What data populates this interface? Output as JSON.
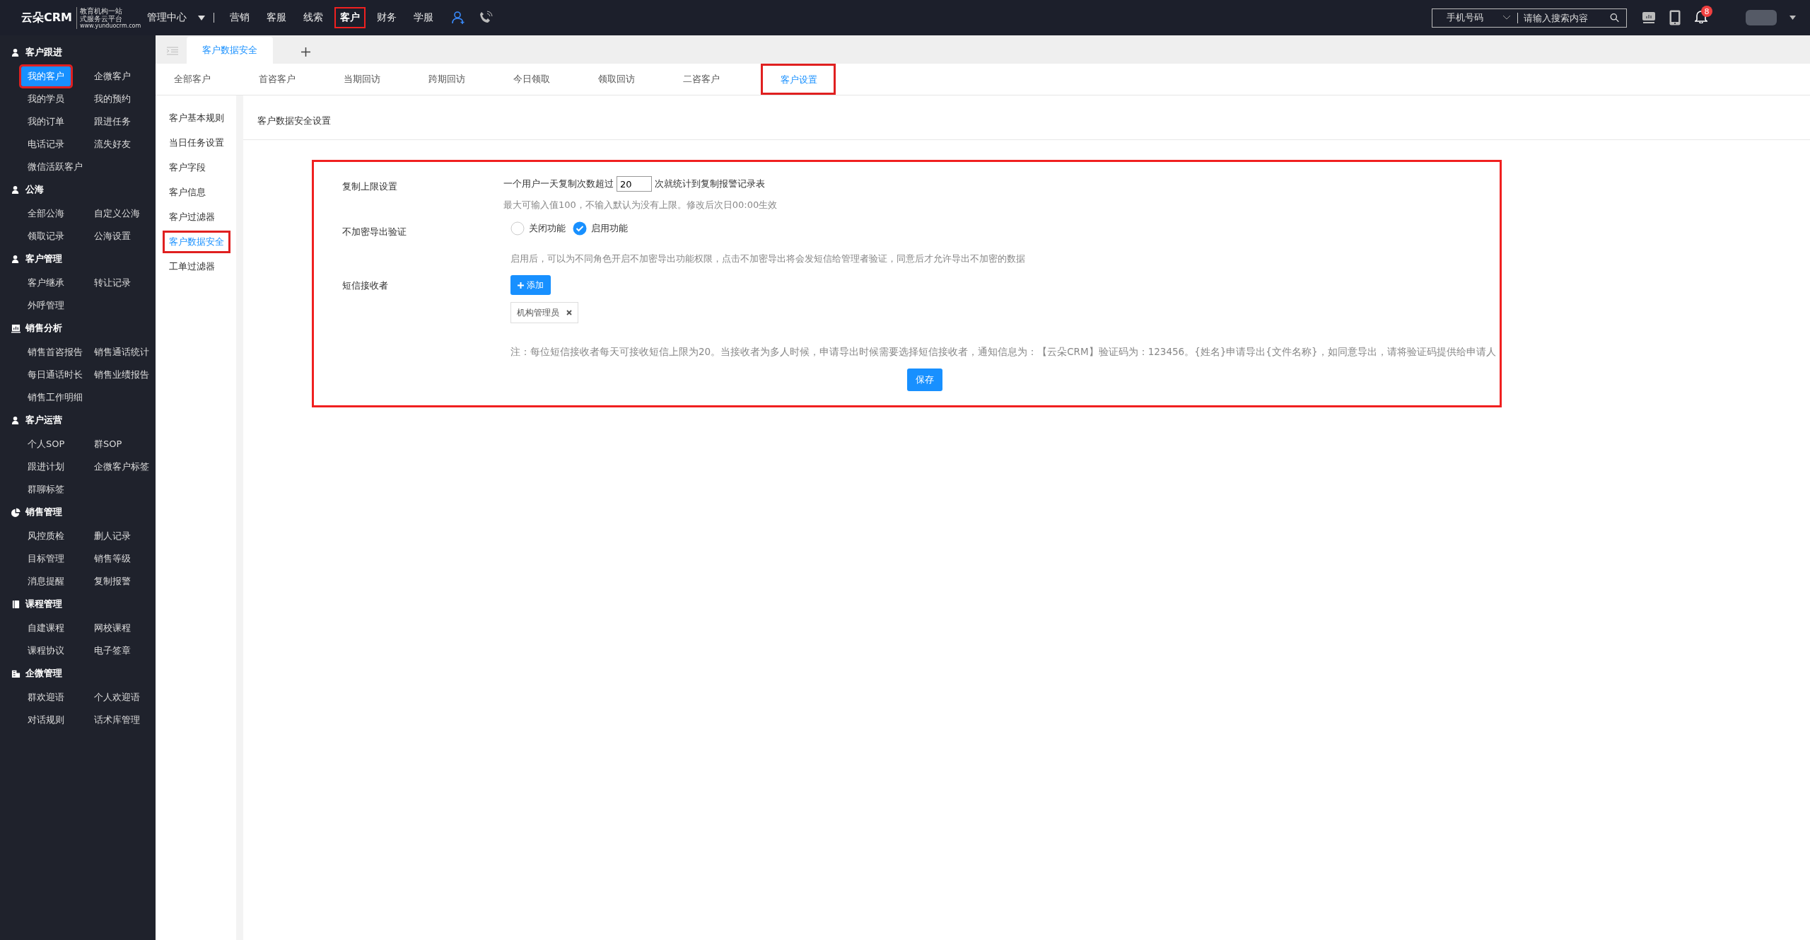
{
  "header": {
    "logo": {
      "name": "云朵CRM",
      "tagline_1": "教育机构一站",
      "tagline_2": "式服务云平台",
      "url": "www.yunduocrm.com"
    },
    "menu_dropdown": "管理中心",
    "nav": [
      {
        "label": "营销",
        "selected": false
      },
      {
        "label": "客服",
        "selected": false
      },
      {
        "label": "线索",
        "selected": false
      },
      {
        "label": "客户",
        "selected": true
      },
      {
        "label": "财务",
        "selected": false
      },
      {
        "label": "学服",
        "selected": false
      }
    ],
    "search": {
      "type": "手机号码",
      "placeholder": "请输入搜索内容"
    },
    "notification_count": "8"
  },
  "sidebar": [
    {
      "title": "客户跟进",
      "kind": "person",
      "items": [
        {
          "label": "我的客户",
          "selected": true
        },
        {
          "label": "企微客户",
          "selected": false
        },
        {
          "label": "我的学员",
          "selected": false
        },
        {
          "label": "我的预约",
          "selected": false
        },
        {
          "label": "我的订单",
          "selected": false
        },
        {
          "label": "跟进任务",
          "selected": false
        },
        {
          "label": "电话记录",
          "selected": false
        },
        {
          "label": "流失好友",
          "selected": false
        },
        {
          "label": "微信活跃客户",
          "selected": false
        }
      ]
    },
    {
      "title": "公海",
      "kind": "person",
      "items": [
        {
          "label": "全部公海",
          "selected": false
        },
        {
          "label": "自定义公海",
          "selected": false
        },
        {
          "label": "领取记录",
          "selected": false
        },
        {
          "label": "公海设置",
          "selected": false
        }
      ]
    },
    {
      "title": "客户管理",
      "kind": "person",
      "items": [
        {
          "label": "客户继承",
          "selected": false
        },
        {
          "label": "转让记录",
          "selected": false
        },
        {
          "label": "外呼管理",
          "selected": false
        }
      ]
    },
    {
      "title": "销售分析",
      "kind": "chart",
      "items": [
        {
          "label": "销售首咨报告",
          "selected": false
        },
        {
          "label": "销售通话统计",
          "selected": false
        },
        {
          "label": "每日通话时长",
          "selected": false
        },
        {
          "label": "销售业绩报告",
          "selected": false
        },
        {
          "label": "销售工作明细",
          "selected": false
        }
      ]
    },
    {
      "title": "客户运营",
      "kind": "person",
      "items": [
        {
          "label": "个人SOP",
          "selected": false
        },
        {
          "label": "群SOP",
          "selected": false
        },
        {
          "label": "跟进计划",
          "selected": false
        },
        {
          "label": "企微客户标签",
          "selected": false
        },
        {
          "label": "群聊标签",
          "selected": false
        }
      ]
    },
    {
      "title": "销售管理",
      "kind": "pie",
      "items": [
        {
          "label": "风控质检",
          "selected": false
        },
        {
          "label": "删人记录",
          "selected": false
        },
        {
          "label": "目标管理",
          "selected": false
        },
        {
          "label": "销售等级",
          "selected": false
        },
        {
          "label": "消息提醒",
          "selected": false
        },
        {
          "label": "复制报警",
          "selected": false
        }
      ]
    },
    {
      "title": "课程管理",
      "kind": "book",
      "items": [
        {
          "label": "自建课程",
          "selected": false
        },
        {
          "label": "网校课程",
          "selected": false
        },
        {
          "label": "课程协议",
          "selected": false
        },
        {
          "label": "电子签章",
          "selected": false
        }
      ]
    },
    {
      "title": "企微管理",
      "kind": "building",
      "items": [
        {
          "label": "群欢迎语",
          "selected": false
        },
        {
          "label": "个人欢迎语",
          "selected": false
        },
        {
          "label": "对话规则",
          "selected": false
        },
        {
          "label": "话术库管理",
          "selected": false
        }
      ]
    }
  ],
  "page_tabs": [
    {
      "label": "客户数据安全",
      "selected": true
    }
  ],
  "sub_tabs": [
    {
      "label": "全部客户",
      "selected": false
    },
    {
      "label": "首咨客户",
      "selected": false
    },
    {
      "label": "当期回访",
      "selected": false
    },
    {
      "label": "跨期回访",
      "selected": false
    },
    {
      "label": "今日领取",
      "selected": false
    },
    {
      "label": "领取回访",
      "selected": false
    },
    {
      "label": "二咨客户",
      "selected": false
    },
    {
      "label": "客户设置",
      "selected": true
    }
  ],
  "settings_menu": [
    {
      "label": "客户基本规则",
      "selected": false
    },
    {
      "label": "当日任务设置",
      "selected": false
    },
    {
      "label": "客户字段",
      "selected": false
    },
    {
      "label": "客户信息",
      "selected": false
    },
    {
      "label": "客户过滤器",
      "selected": false
    },
    {
      "label": "客户数据安全",
      "selected": true
    },
    {
      "label": "工单过滤器",
      "selected": false
    }
  ],
  "panel_title": "客户数据安全设置",
  "form": {
    "highlighted": true,
    "rows": [
      {
        "kind": "limit",
        "label": "复制上限设置",
        "prefix": "一个用户一天复制次数超过",
        "value": "20",
        "suffix": "次就统计到复制报警记录表",
        "hint": "最大可输入值100，不输入默认为没有上限。修改后次日00:00生效"
      },
      {
        "kind": "radio",
        "label": "不加密导出验证",
        "options": [
          {
            "label": "关闭功能",
            "selected": false
          },
          {
            "label": "启用功能",
            "selected": true
          }
        ],
        "hint": "启用后，可以为不同角色开启不加密导出功能权限，点击不加密导出将会发短信给管理者验证，同意后才允许导出不加密的数据"
      },
      {
        "kind": "recipients",
        "label": "短信接收者",
        "add_button": "添加",
        "recipients": [
          "机构管理员"
        ],
        "note": "注：每位短信接收者每天可接收短信上限为20。当接收者为多人时候，申请导出时候需要选择短信接收者，通知信息为：【云朵CRM】验证码为：123456。{姓名}申请导出{文件名称}，如同意导出，请将验证码提供给申请人"
      }
    ],
    "save_button": "保存"
  }
}
